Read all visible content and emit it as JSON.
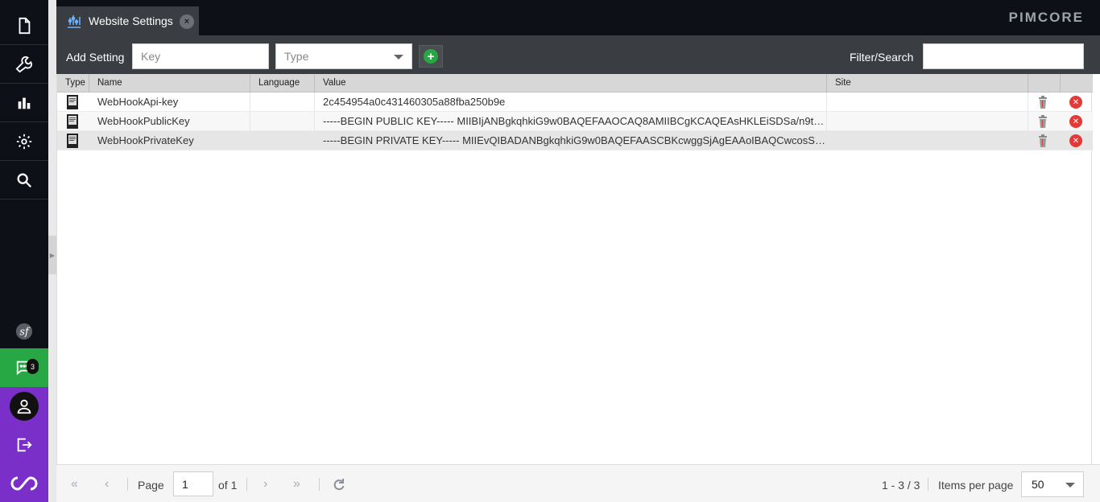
{
  "app": {
    "logo_text": "PIMCORE"
  },
  "sidebar": {
    "items": [
      {
        "icon": "document-icon"
      },
      {
        "icon": "wrench-icon"
      },
      {
        "icon": "bar-chart-icon"
      },
      {
        "icon": "gear-icon"
      },
      {
        "icon": "search-icon"
      }
    ],
    "notification_count": "3"
  },
  "tab": {
    "label": "Website Settings",
    "close_label": "×"
  },
  "toolbar": {
    "add_setting_label": "Add Setting",
    "key_placeholder": "Key",
    "type_placeholder": "Type",
    "add_button_label": "+",
    "filter_label": "Filter/Search",
    "filter_value": ""
  },
  "grid": {
    "columns": [
      "Type",
      "Name",
      "Language",
      "Value",
      "Site",
      "",
      ""
    ],
    "rows": [
      {
        "name": "WebHookApi-key",
        "language": "",
        "value": "2c454954a0c431460305a88fba250b9e",
        "site": ""
      },
      {
        "name": "WebHookPublicKey",
        "language": "",
        "value": "-----BEGIN PUBLIC KEY----- MIIBIjANBgkqhkiG9w0BAQEFAAOCAQ8AMIIBCgKCAQEAsHKLEiSDSa/n9tG...",
        "site": ""
      },
      {
        "name": "WebHookPrivateKey",
        "language": "",
        "value": "-----BEGIN PRIVATE KEY----- MIIEvQIBADANBgkqhkiG9w0BAQEFAASCBKcwggSjAgEAAoIBAQCwcosSJI...",
        "site": ""
      }
    ]
  },
  "pager": {
    "page_label": "Page",
    "page_value": "1",
    "of_label": "of 1",
    "range_text": "1 - 3 / 3",
    "items_per_page_label": "Items per page",
    "items_per_page_value": "50"
  },
  "colors": {
    "accent_green": "#28a745",
    "accent_purple": "#7b2fc9",
    "delete_red": "#e53935",
    "dark_bg": "#0d1117"
  }
}
